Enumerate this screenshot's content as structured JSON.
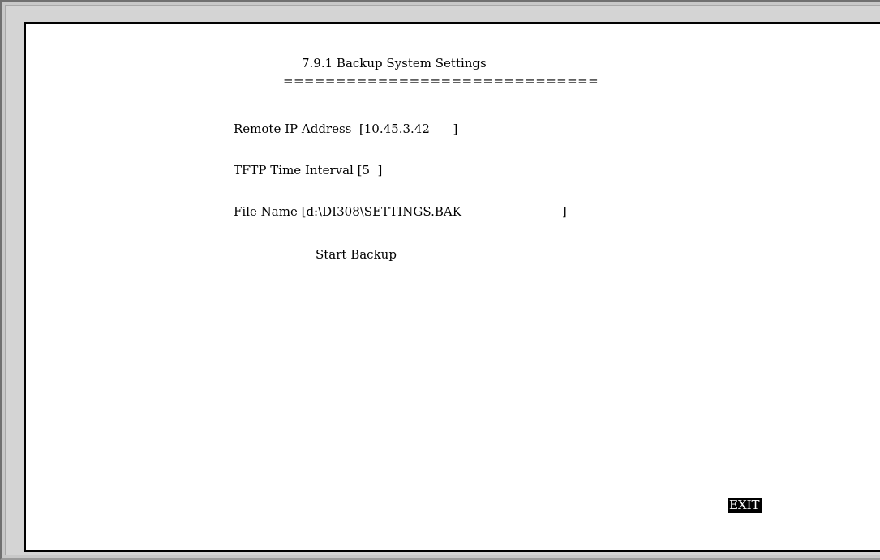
{
  "screen": {
    "title": "7.9.1 Backup System Settings",
    "underline": "=============================="
  },
  "fields": {
    "remote_ip": {
      "label": "Remote IP Address  ",
      "value": "[10.45.3.42      ]"
    },
    "tftp_interval": {
      "label": "TFTP Time Interval ",
      "value": "[5  ]"
    },
    "file_name": {
      "label": "File Name ",
      "value": "[d:\\DI308\\SETTINGS.BAK                          ]"
    }
  },
  "actions": {
    "start_backup": "Start Backup",
    "exit": "EXIT"
  }
}
